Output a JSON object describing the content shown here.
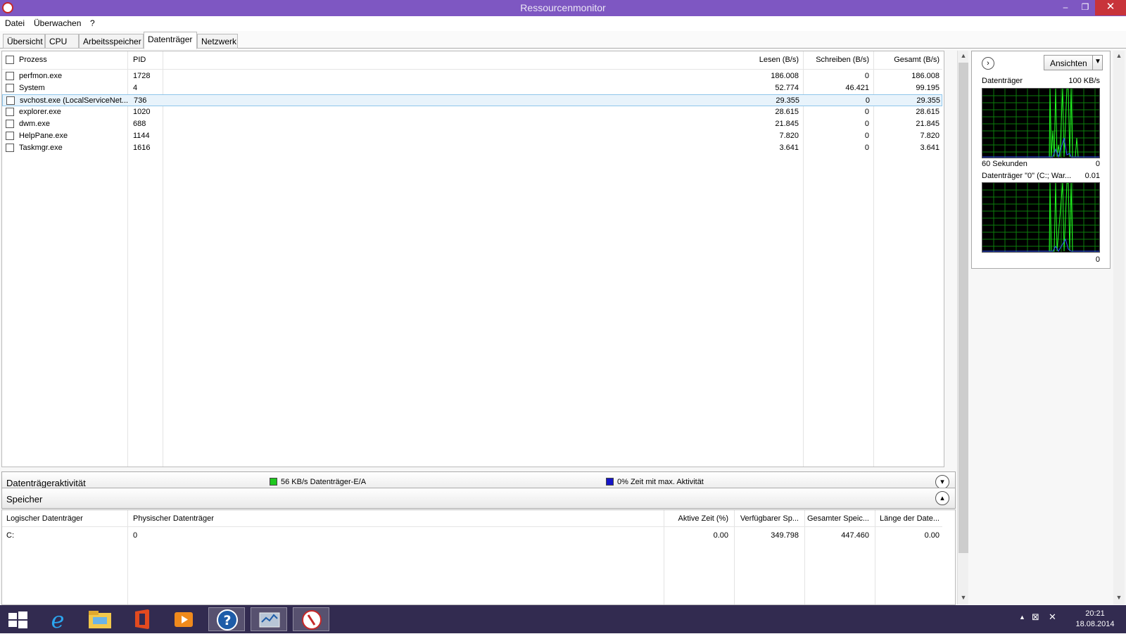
{
  "window": {
    "title": "Ressourcenmonitor",
    "minimize": "–",
    "maximize": "❐",
    "close": "✕"
  },
  "menu": [
    "Datei",
    "Überwachen",
    "?"
  ],
  "tabs": [
    "Übersicht",
    "CPU",
    "Arbeitsspeicher",
    "Datenträger",
    "Netzwerk"
  ],
  "active_tab": "Datenträger",
  "process_table": {
    "headers": {
      "process": "Prozess",
      "pid": "PID",
      "read": "Lesen (B/s)",
      "write": "Schreiben (B/s)",
      "total": "Gesamt (B/s)"
    },
    "rows": [
      {
        "name": "perfmon.exe",
        "pid": "1728",
        "read": "186.008",
        "write": "0",
        "total": "186.008",
        "selected": false
      },
      {
        "name": "System",
        "pid": "4",
        "read": "52.774",
        "write": "46.421",
        "total": "99.195",
        "selected": false
      },
      {
        "name": "svchost.exe (LocalServiceNet...",
        "pid": "736",
        "read": "29.355",
        "write": "0",
        "total": "29.355",
        "selected": true
      },
      {
        "name": "explorer.exe",
        "pid": "1020",
        "read": "28.615",
        "write": "0",
        "total": "28.615",
        "selected": false
      },
      {
        "name": "dwm.exe",
        "pid": "688",
        "read": "21.845",
        "write": "0",
        "total": "21.845",
        "selected": false
      },
      {
        "name": "HelpPane.exe",
        "pid": "1144",
        "read": "7.820",
        "write": "0",
        "total": "7.820",
        "selected": false
      },
      {
        "name": "Taskmgr.exe",
        "pid": "1616",
        "read": "3.641",
        "write": "0",
        "total": "3.641",
        "selected": false
      }
    ]
  },
  "activity_section": {
    "title": "Datenträgeraktivität",
    "legend_io": "56 KB/s Datenträger-E/A",
    "legend_io_color": "#1ec81e",
    "legend_time": "0% Zeit mit max. Aktivität",
    "legend_time_color": "#1414c8"
  },
  "storage_section": {
    "title": "Speicher",
    "headers": {
      "logical": "Logischer Datenträger",
      "physical": "Physischer Datenträger",
      "active": "Aktive Zeit (%)",
      "avail": "Verfügbarer Sp...",
      "total": "Gesamter Speic...",
      "queue": "Länge der Date..."
    },
    "rows": [
      {
        "logical": "C:",
        "physical": "0",
        "active": "0.00",
        "avail": "349.798",
        "total": "447.460",
        "queue": "0.00"
      }
    ]
  },
  "side_panel": {
    "views_button": "Ansichten",
    "graph1": {
      "title": "Datenträger",
      "max": "100 KB/s",
      "span": "60 Sekunden",
      "min": "0"
    },
    "graph2": {
      "title": "Datenträger \"0\" (C:; War...",
      "max": "0.01",
      "min": "0"
    }
  },
  "taskbar": {
    "time": "20:21",
    "date": "18.08.2014"
  }
}
